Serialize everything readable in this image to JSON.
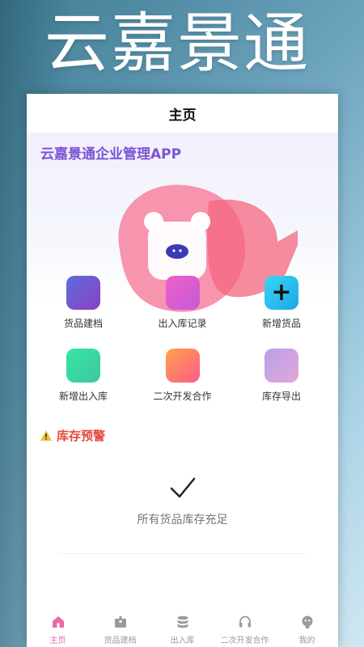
{
  "promo_title": "云嘉景通",
  "nav": {
    "title": "主页"
  },
  "hero": {
    "title": "云嘉景通企业管理APP"
  },
  "grid": [
    {
      "label": "货品建档",
      "icon": "box-tile-icon",
      "gradient": [
        "#5b6ee0",
        "#8d3fbf"
      ]
    },
    {
      "label": "出入库记录",
      "icon": "record-tile-icon",
      "gradient": [
        "#f060c8",
        "#c35ad8"
      ]
    },
    {
      "label": "新增货品",
      "icon": "plus-tile-icon",
      "glyph": "+",
      "gradient": [
        "#36d7f2",
        "#1fa6e8"
      ]
    },
    {
      "label": "新增出入库",
      "icon": "inout-tile-icon",
      "gradient": [
        "#35e6a3",
        "#3fc6a0"
      ]
    },
    {
      "label": "二次开发合作",
      "icon": "cooperate-tile-icon",
      "gradient": [
        "#ffa24a",
        "#ff5a8a"
      ]
    },
    {
      "label": "库存导出",
      "icon": "export-tile-icon",
      "gradient": [
        "#b8a0e8",
        "#e0a8d8"
      ]
    }
  ],
  "warning": {
    "title": "库存预警",
    "icon": "warning-icon",
    "color": "#e2483d"
  },
  "empty_state": {
    "text": "所有货品库存充足",
    "icon": "check-icon"
  },
  "tabbar": [
    {
      "label": "主页",
      "icon": "home-icon",
      "active": true
    },
    {
      "label": "货品建档",
      "icon": "box-icon",
      "active": false
    },
    {
      "label": "出入库",
      "icon": "database-icon",
      "active": false
    },
    {
      "label": "二次开发合作",
      "icon": "headset-icon",
      "active": false
    },
    {
      "label": "我的",
      "icon": "user-icon",
      "active": false
    }
  ],
  "colors": {
    "accent": "#e86aa8",
    "brand_purple": "#7b54d4"
  }
}
